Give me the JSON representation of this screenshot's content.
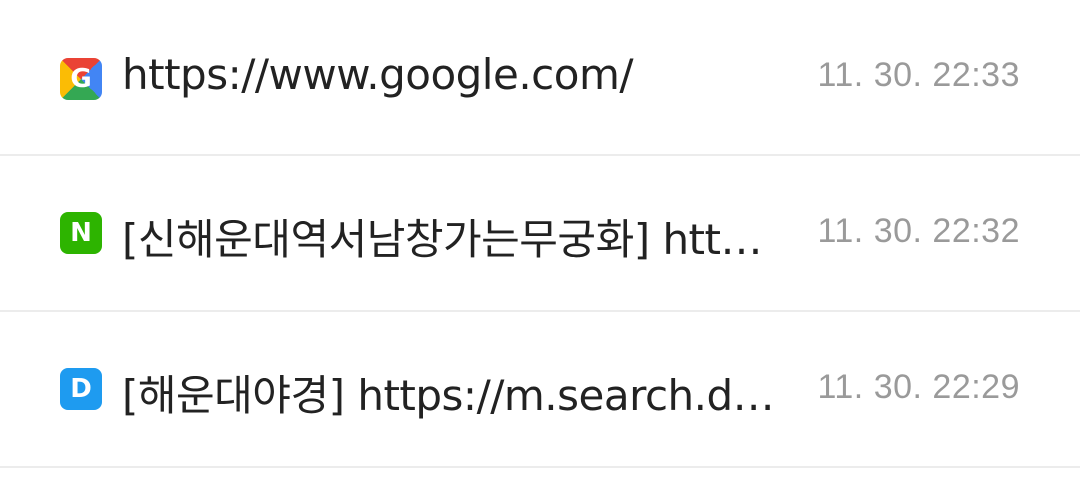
{
  "history": {
    "items": [
      {
        "icon_name": "google-icon",
        "icon_text": "G",
        "title": "https://www.google.com/",
        "time": "11. 30. 22:33"
      },
      {
        "icon_name": "naver-icon",
        "icon_text": "N",
        "title": "[신해운대역서남창가는무궁화] http…",
        "time": "11. 30. 22:32"
      },
      {
        "icon_name": "daum-icon",
        "icon_text": "D",
        "title": "[해운대야경] https://m.search.da…",
        "time": "11. 30. 22:29"
      }
    ]
  }
}
